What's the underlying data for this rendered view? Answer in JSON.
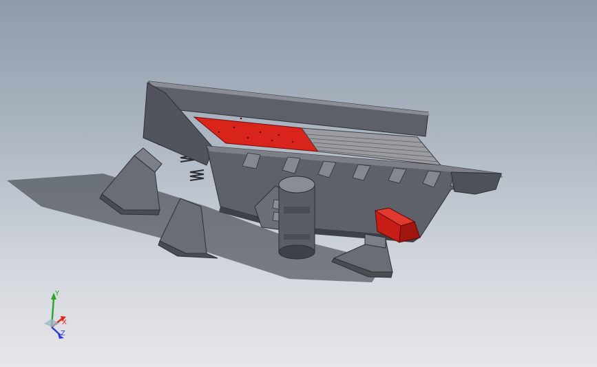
{
  "viewport": {
    "background_top": "#8f9bab",
    "background_bottom": "#e6e7ea",
    "model": "vibrating-screen-feeder",
    "colors": {
      "frame": "#5e6169",
      "frame_light": "#7c7f88",
      "frame_dark": "#3f4148",
      "screen_plate": "#d9241c",
      "grizzly_bars": "#9a9ca1",
      "motor_guard": "#c71d17"
    }
  },
  "triad": {
    "x_label": "X",
    "y_label": "Y",
    "z_label": "Z",
    "x_color": "#e0261a",
    "y_color": "#2fa52a",
    "z_color": "#2a3ce0"
  }
}
